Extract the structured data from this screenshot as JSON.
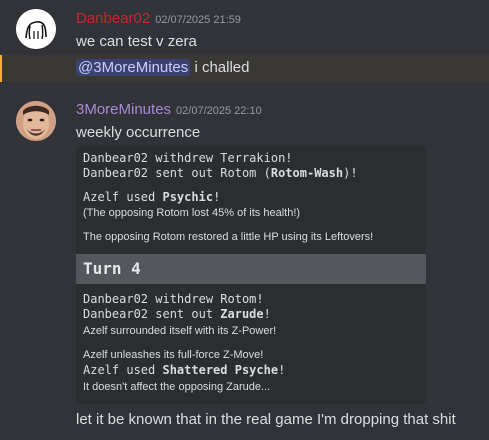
{
  "messages": {
    "first": {
      "username": "Danbear02",
      "username_color": "#c32b2b",
      "timestamp": "02/07/2025 21:59",
      "text": "we can test v zera"
    },
    "mention": {
      "mention": "@3MoreMinutes",
      "text": " i challed"
    },
    "second": {
      "username": "3MoreMinutes",
      "username_color": "#a88bd6",
      "timestamp": "02/07/2025 22:10",
      "text": "weekly occurrence",
      "last_text": "let it be known that in the real game I'm dropping that shit"
    }
  },
  "battle_log": {
    "line1": "Danbear02 withdrew Terrakion!",
    "line2_a": "Danbear02 sent out Rotom (",
    "line2_b": "Rotom-Wash",
    "line2_c": ")!",
    "line3_a": "Azelf used ",
    "line3_b": "Psychic",
    "line3_c": "!",
    "line4": "(The opposing Rotom lost 45% of its health!)",
    "line5": "The opposing Rotom restored a little HP using its Leftovers!",
    "turn": "Turn 4",
    "line6": "Danbear02 withdrew Rotom!",
    "line7_a": "Danbear02 sent out ",
    "line7_b": "Zarude",
    "line7_c": "!",
    "line8": "Azelf surrounded itself with its Z-Power!",
    "line9": "Azelf unleashes its full-force Z-Move!",
    "line10_a": "Azelf used ",
    "line10_b": "Shattered Psyche",
    "line10_c": "!",
    "line11": "It doesn't affect the opposing Zarude..."
  }
}
